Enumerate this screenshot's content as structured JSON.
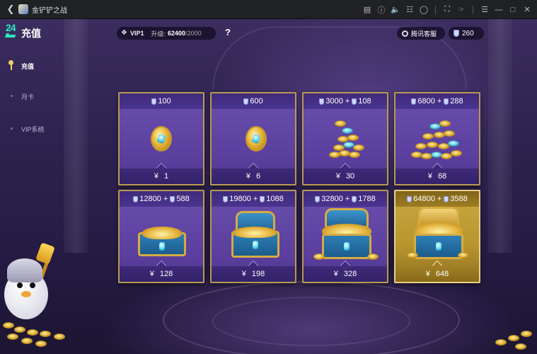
{
  "window": {
    "title": "金铲铲之战"
  },
  "header": {
    "page_title": "充值",
    "vip_level": "VIP1",
    "upgrade_label": "升级:",
    "progress_current": "62400",
    "progress_max": "/2000",
    "help_label": "?",
    "service_label": "腾讯客服",
    "currency_balance": "260"
  },
  "sidebar": {
    "items": [
      {
        "label": "充值",
        "active": true
      },
      {
        "label": "月卡",
        "active": false
      },
      {
        "label": "VIP系统",
        "active": false
      }
    ]
  },
  "packs": [
    {
      "amount": "100",
      "bonus": "",
      "price": "1",
      "art": "coin"
    },
    {
      "amount": "600",
      "bonus": "",
      "price": "6",
      "art": "coin"
    },
    {
      "amount": "3000",
      "bonus": "108",
      "price": "30",
      "art": "stack-small"
    },
    {
      "amount": "6800",
      "bonus": "288",
      "price": "68",
      "art": "stack-large"
    },
    {
      "amount": "12800",
      "bonus": "588",
      "price": "128",
      "art": "chest-open-small"
    },
    {
      "amount": "19800",
      "bonus": "1088",
      "price": "198",
      "art": "chest-open"
    },
    {
      "amount": "32800",
      "bonus": "1788",
      "price": "328",
      "art": "chest-full"
    },
    {
      "amount": "64800",
      "bonus": "3588",
      "price": "648",
      "art": "chest-premium",
      "highlight": true
    }
  ],
  "symbols": {
    "yen": "¥",
    "plus": "+"
  },
  "colors": {
    "card_border": "#b89a54",
    "card_purple": "#5b3f9e",
    "premium_gold": "#c9a742",
    "logo_teal": "#2ee6c0"
  }
}
